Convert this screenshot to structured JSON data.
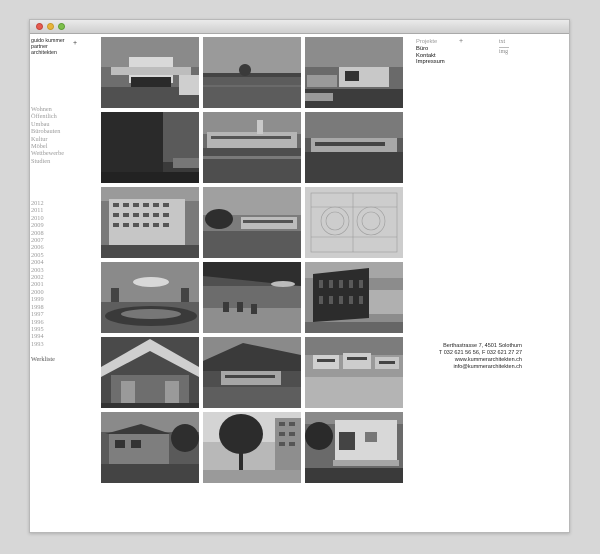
{
  "logo": {
    "line1": "guido kummer",
    "plus": "+",
    "line2": "partner",
    "line3": "architekten"
  },
  "categories": [
    "Wohnen",
    "Öffentlich",
    "Umbau",
    "Bürobauten",
    "Kultur",
    "Möbel",
    "Wettbewerbe",
    "Studien"
  ],
  "years": [
    "2012",
    "2011",
    "2010",
    "2009",
    "2008",
    "2007",
    "2006",
    "2005",
    "2004",
    "2003",
    "2002",
    "2001",
    "2000",
    "1999",
    "1998",
    "1997",
    "1996",
    "1995",
    "1994",
    "1993"
  ],
  "werkliste": "Werkliste",
  "nav": {
    "plus": "+",
    "items": [
      "Projekte",
      "Büro",
      "Kontakt",
      "Impressum"
    ]
  },
  "view_toggle": {
    "list": "txt",
    "images": "img"
  },
  "contact": {
    "address": "Berthastrasse 7, 4501 Solothurn",
    "phone": "T 032 621 56 56, F 032 621 27 27",
    "web": "www.kummerarchitekten.ch",
    "email": "info@kummerarchitekten.ch"
  },
  "colors": {
    "page_background": "#d7d7d7",
    "window": "#ffffff",
    "text": "#222222",
    "muted_text": "#9a9a9a"
  }
}
